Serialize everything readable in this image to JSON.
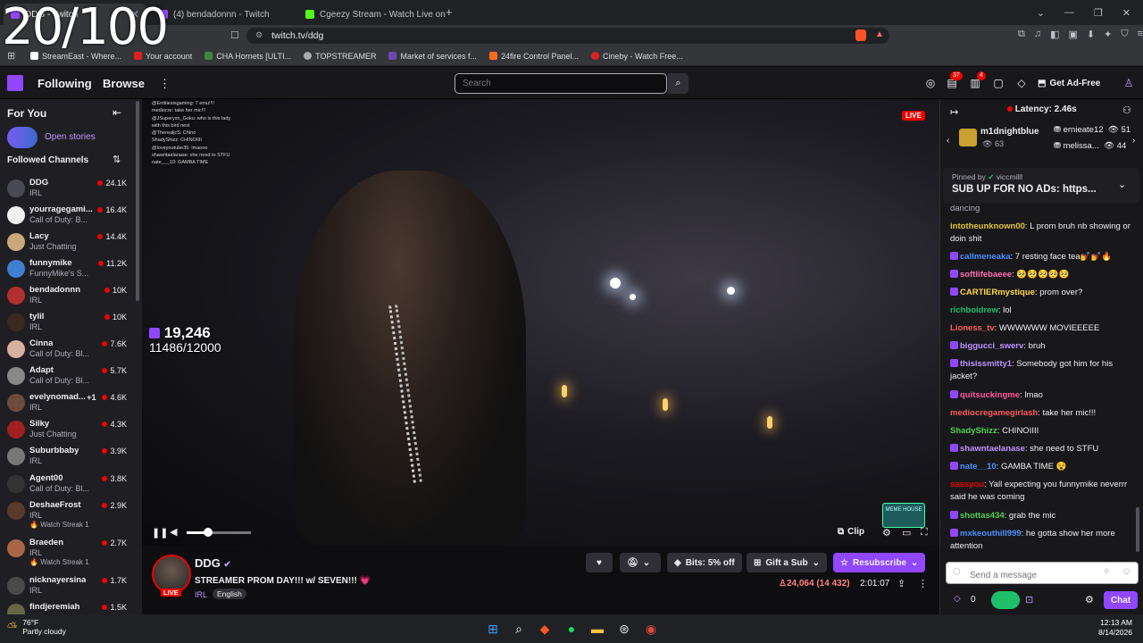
{
  "overlay_counter": "20/100",
  "browser": {
    "tabs": [
      {
        "title": "DDG - Twitch",
        "active": true
      },
      {
        "title": "(4) bendadonnn - Twitch",
        "active": false
      },
      {
        "title": "Cgeezy Stream - Watch Live on Kick",
        "active": false
      }
    ],
    "url": "twitch.tv/ddg",
    "bookmarks": [
      "StreamEast - Where...",
      "Your account",
      "CHA Hornets [ULTI...",
      "TOPSTREAMER",
      "Market of services f...",
      "24fire Control Panel...",
      "Cineby - Watch Free..."
    ]
  },
  "nav": {
    "following": "Following",
    "browse": "Browse",
    "search_placeholder": "Search",
    "notifications_badge": "37",
    "whispers_badge": "4",
    "get_ad_free": "Get Ad-Free"
  },
  "sidebar": {
    "for_you": "For You",
    "open_stories": "Open stories",
    "followed_channels": "Followed Channels",
    "channels": [
      {
        "name": "DDG",
        "game": "IRL",
        "viewers": "24.1K",
        "color": "#4a4a52"
      },
      {
        "name": "yourragegami...",
        "game": "Call of Duty: B...",
        "viewers": "16.4K",
        "color": "#f0f0f0"
      },
      {
        "name": "Lacy",
        "game": "Just Chatting",
        "viewers": "14.4K",
        "color": "#c9a97b"
      },
      {
        "name": "funnymike",
        "game": "FunnyMike's S...",
        "viewers": "11.2K",
        "color": "#3f7fd0"
      },
      {
        "name": "bendadonnn",
        "game": "IRL",
        "viewers": "10K",
        "color": "#b03030"
      },
      {
        "name": "tylil",
        "game": "IRL",
        "viewers": "10K",
        "color": "#3a2a20"
      },
      {
        "name": "Cinna",
        "game": "Call of Duty: Bl...",
        "viewers": "7.6K",
        "color": "#d8b0a0"
      },
      {
        "name": "Adapt",
        "game": "Call of Duty: Bl...",
        "viewers": "5.7K",
        "color": "#888"
      },
      {
        "name": "evelynomad...",
        "game": "IRL",
        "viewers": "4.6K",
        "extra": "+1",
        "color": "#6b4b3b"
      },
      {
        "name": "Silky",
        "game": "Just Chatting",
        "viewers": "4.3K",
        "color": "#a02020"
      },
      {
        "name": "Suburbbaby",
        "game": "IRL",
        "viewers": "3.9K",
        "color": "#777"
      },
      {
        "name": "Agent00",
        "game": "Call of Duty: Bl...",
        "viewers": "3.8K",
        "color": "#333"
      },
      {
        "name": "DeshaeFrost",
        "game": "IRL",
        "viewers": "2.9K",
        "streak": "Watch Streak 1",
        "color": "#5a3a2a"
      },
      {
        "name": "Braeden",
        "game": "IRL",
        "viewers": "2.7K",
        "streak": "Watch Streak 1",
        "color": "#aa6644"
      },
      {
        "name": "nicknayersina",
        "game": "IRL",
        "viewers": "1.7K",
        "color": "#4a4a4a"
      },
      {
        "name": "findjeremiah",
        "game": "",
        "viewers": "1.5K",
        "color": "#664"
      }
    ]
  },
  "video": {
    "live_label": "LIVE",
    "overlay_count": "19,246",
    "overlay_goal": "11486/12000",
    "clip_label": "Clip",
    "volume_level": 0.33,
    "watermark": "MEME HOUSE",
    "overlay_chat": [
      "@Entitiesisgaming: 7 emu!!!!",
      "mediocre: take her mic!!!",
      "@JSuperysn_Goku: who is this lady",
      "with this bird nest",
      "@TherealjcS: Chino",
      "ShadyShizz: CHINOIIII",
      "@loveyoutube35: lmaooo",
      "shawntaelanase: she need to STFU",
      "nate___10: GAMBA TIME"
    ]
  },
  "stream": {
    "channel": "DDG",
    "live": "LIVE",
    "title": "STREAMER PROM DAY!!! w/ SEVEN!!! 💗",
    "category": "IRL",
    "language": "English",
    "bits": "Bits: 5% off",
    "gift": "Gift a Sub",
    "resubscribe": "Resubscribe",
    "viewers": "24,064 (14 432)",
    "uptime": "2:01:07"
  },
  "chat": {
    "latency": "Latency: 2.46s",
    "hype": [
      {
        "name": "m1dnightblue",
        "count": "63"
      },
      {
        "name": "ernieate12",
        "count": "51"
      },
      {
        "name": "melissa...",
        "count": "44"
      }
    ],
    "pinned_by": "Pinned by",
    "pinned_user": "viccmilll",
    "pinned_text": "SUB UP FOR NO ADs: https...",
    "partial_line": "dancing",
    "messages": [
      {
        "user": "intotheunknown00",
        "color": "#e0c640",
        "text": "L prom bruh nb showing or doin shit"
      },
      {
        "user": "callmeneaka",
        "color": "#4a90ff",
        "text": "7 resting face tea💅💅🔥"
      },
      {
        "user": "softlifebaeee",
        "color": "#ff6fb0",
        "text": "🥺🥺🥺🥺🥺"
      },
      {
        "user": "CARTIERmystique",
        "color": "#ffd84a",
        "text": "prom over?"
      },
      {
        "user": "richboidrew",
        "color": "#1fbf6a",
        "text": "lol"
      },
      {
        "user": "Lioness_tv",
        "color": "#ff5a5a",
        "text": "WWWWWW MOVIEEEEE"
      },
      {
        "user": "biggucci_swerv",
        "color": "#bf94ff",
        "text": "bruh"
      },
      {
        "user": "thisissmitty1",
        "color": "#bf94ff",
        "text": "Somebody got him for his jacket?"
      },
      {
        "user": "quitsuckingme",
        "color": "#ff5a9a",
        "text": "lmao"
      },
      {
        "user": "mediocregamegirlash",
        "color": "#ff5a5a",
        "text": "take her mic!!!"
      },
      {
        "user": "ShadyShizz",
        "color": "#4fd04f",
        "text": "CHINOIIII"
      },
      {
        "user": "shawntaelanase",
        "color": "#bf94ff",
        "text": "she need to STFU"
      },
      {
        "user": "nate__10",
        "color": "#4a90ff",
        "text": "GAMBA TIME 😵"
      },
      {
        "user": "sassyou",
        "color": "#eb0400",
        "text": "Yall expecting you funnymike neverrr said he was coming"
      },
      {
        "user": "shottas434",
        "color": "#4fd04f",
        "text": "grab the mic"
      },
      {
        "user": "mxkeouthill999",
        "color": "#4a90ff",
        "text": "he gotta show her more attention"
      }
    ],
    "send_placeholder": "Send a message",
    "points": "0",
    "chat_button": "Chat"
  },
  "taskbar": {
    "temp": "76°F",
    "weather": "Partly cloudy",
    "time": "12:13 AM",
    "date": "8/14/2026"
  }
}
